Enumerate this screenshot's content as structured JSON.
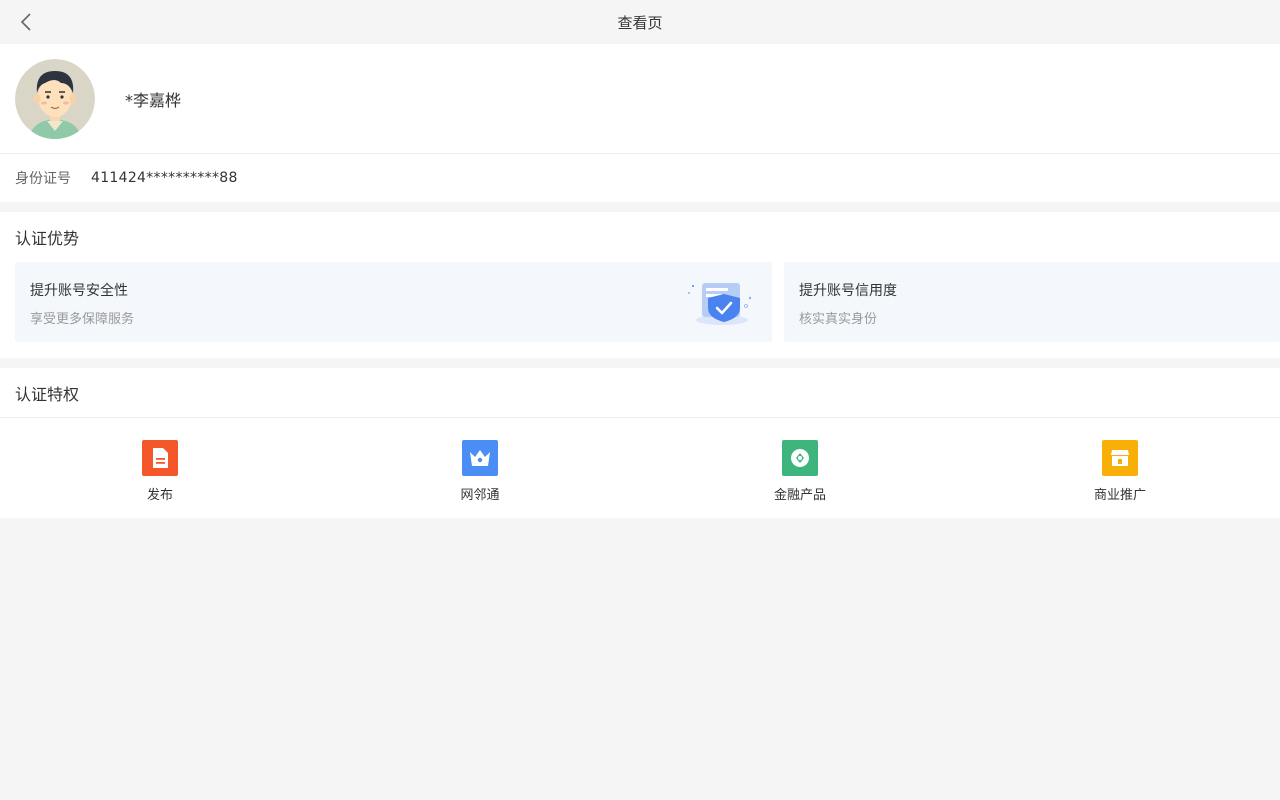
{
  "header": {
    "title": "查看页",
    "back_icon": "chevron-left-icon"
  },
  "profile": {
    "name": "*李嘉桦",
    "avatar_icon": "user-avatar-illustration"
  },
  "identity": {
    "label": "身份证号",
    "value": "411424**********88"
  },
  "advantages": {
    "title": "认证优势",
    "cards": [
      {
        "title": "提升账号安全性",
        "subtitle": "享受更多保障服务",
        "icon": "shield-check-icon"
      },
      {
        "title": "提升账号信用度",
        "subtitle": "核实真实身份"
      }
    ]
  },
  "privileges": {
    "title": "认证特权",
    "items": [
      {
        "label": "发布",
        "icon": "document-icon",
        "color": "#f4572a"
      },
      {
        "label": "网邻通",
        "icon": "crown-icon",
        "color": "#4a8ef5"
      },
      {
        "label": "金融产品",
        "icon": "coin-icon",
        "color": "#3db57c"
      },
      {
        "label": "商业推广",
        "icon": "shop-icon",
        "color": "#f8b008"
      }
    ]
  }
}
